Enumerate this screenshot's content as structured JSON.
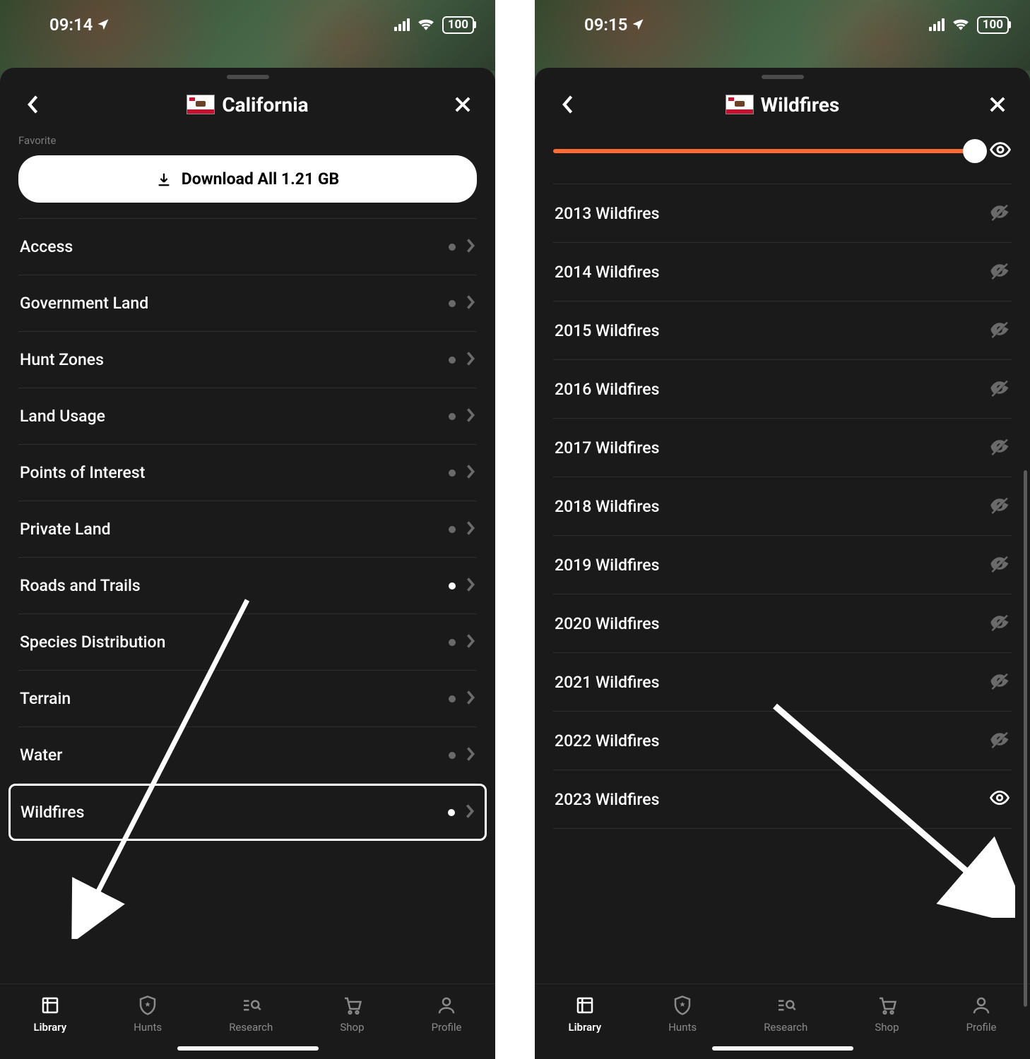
{
  "left": {
    "status": {
      "time": "09:14",
      "battery": "100"
    },
    "title": "California",
    "favorite_label": "Favorite",
    "download_label": "Download All 1.21 GB",
    "categories": [
      {
        "label": "Access",
        "active": false,
        "highlight": false
      },
      {
        "label": "Government Land",
        "active": false,
        "highlight": false
      },
      {
        "label": "Hunt Zones",
        "active": false,
        "highlight": false
      },
      {
        "label": "Land Usage",
        "active": false,
        "highlight": false
      },
      {
        "label": "Points of Interest",
        "active": false,
        "highlight": false
      },
      {
        "label": "Private Land",
        "active": false,
        "highlight": false
      },
      {
        "label": "Roads and Trails",
        "active": true,
        "highlight": false
      },
      {
        "label": "Species Distribution",
        "active": false,
        "highlight": false
      },
      {
        "label": "Terrain",
        "active": false,
        "highlight": false
      },
      {
        "label": "Water",
        "active": false,
        "highlight": false
      },
      {
        "label": "Wildfires",
        "active": true,
        "highlight": true
      }
    ]
  },
  "right": {
    "status": {
      "time": "09:15",
      "battery": "100"
    },
    "title": "Wildfires",
    "slider_value": 100,
    "years": [
      {
        "label": "2013 Wildfires",
        "visible": false
      },
      {
        "label": "2014 Wildfires",
        "visible": false
      },
      {
        "label": "2015 Wildfires",
        "visible": false
      },
      {
        "label": "2016 Wildfires",
        "visible": false
      },
      {
        "label": "2017 Wildfires",
        "visible": false
      },
      {
        "label": "2018 Wildfires",
        "visible": false
      },
      {
        "label": "2019 Wildfires",
        "visible": false
      },
      {
        "label": "2020 Wildfires",
        "visible": false
      },
      {
        "label": "2021 Wildfires",
        "visible": false
      },
      {
        "label": "2022 Wildfires",
        "visible": false
      },
      {
        "label": "2023 Wildfires",
        "visible": true
      }
    ]
  },
  "tabs": [
    {
      "label": "Library",
      "icon": "library",
      "active": true
    },
    {
      "label": "Hunts",
      "icon": "shield",
      "active": false
    },
    {
      "label": "Research",
      "icon": "search",
      "active": false
    },
    {
      "label": "Shop",
      "icon": "cart",
      "active": false
    },
    {
      "label": "Profile",
      "icon": "person",
      "active": false
    }
  ]
}
